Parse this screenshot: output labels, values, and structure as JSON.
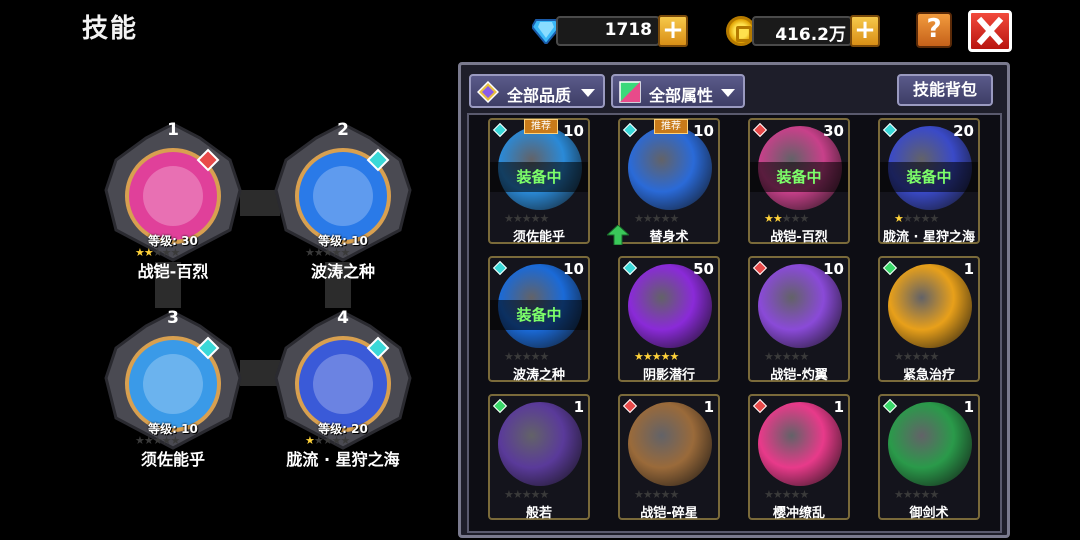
{
  "header": {
    "title": "技能"
  },
  "currency": {
    "gems": "1718",
    "coins": "416.2万",
    "plus": "+"
  },
  "buttons": {
    "help": "?"
  },
  "equipped": [
    {
      "slot": "1",
      "level": "等级: 30",
      "name": "战铠-百烈",
      "stars": 2,
      "color": "#e0409a"
    },
    {
      "slot": "2",
      "level": "等级: 10",
      "name": "波涛之种",
      "stars": 0,
      "color": "#2a7ae8"
    },
    {
      "slot": "3",
      "level": "等级: 10",
      "name": "须佐能乎",
      "stars": 0,
      "color": "#3a9ae8"
    },
    {
      "slot": "4",
      "level": "等级: 20",
      "name": "胧流 · 星狩之海",
      "stars": 1,
      "color": "#3a5ad8"
    }
  ],
  "filters": {
    "quality": "全部品质",
    "attribute": "全部属性",
    "bag": "技能背包"
  },
  "skills": [
    {
      "name": "须佐能乎",
      "count": "10",
      "stars": 0,
      "tag": "推荐",
      "equipped": "装备中",
      "color": "#2a8ad8",
      "qual": "#3ad8d8"
    },
    {
      "name": "替身术",
      "count": "10",
      "stars": 0,
      "tag": "推荐",
      "equipped": "",
      "color": "#2a6ad8",
      "qual": "#3ad8d8"
    },
    {
      "name": "战铠-百烈",
      "count": "30",
      "stars": 2,
      "tag": "",
      "equipped": "装备中",
      "color": "#c8408a",
      "qual": "#e84a4a"
    },
    {
      "name": "胧流 · 星狩之海",
      "count": "20",
      "stars": 1,
      "tag": "",
      "equipped": "装备中",
      "color": "#3a4ac8",
      "qual": "#3ad8d8"
    },
    {
      "name": "波涛之种",
      "count": "10",
      "stars": 0,
      "tag": "",
      "equipped": "装备中",
      "color": "#1a6ad8",
      "qual": "#3ad8d8"
    },
    {
      "name": "阴影潜行",
      "count": "50",
      "stars": 5,
      "tag": "",
      "equipped": "",
      "color": "#8a2ad8",
      "qual": "#3ad8d8"
    },
    {
      "name": "战铠-灼翼",
      "count": "10",
      "stars": 0,
      "tag": "",
      "equipped": "",
      "color": "#8a4ad8",
      "qual": "#e84a4a"
    },
    {
      "name": "紧急治疗",
      "count": "1",
      "stars": 0,
      "tag": "",
      "equipped": "",
      "color": "#e8a01a",
      "qual": "#3ad86a"
    },
    {
      "name": "般若",
      "count": "1",
      "stars": 0,
      "tag": "",
      "equipped": "",
      "color": "#5a3a9a",
      "qual": "#3ad86a"
    },
    {
      "name": "战铠-碎星",
      "count": "1",
      "stars": 0,
      "tag": "",
      "equipped": "",
      "color": "#9a6a3a",
      "qual": "#e84a4a"
    },
    {
      "name": "樱冲缭乱",
      "count": "1",
      "stars": 0,
      "tag": "",
      "equipped": "",
      "color": "#e83a8a",
      "qual": "#e84a4a"
    },
    {
      "name": "御剑术",
      "count": "1",
      "stars": 0,
      "tag": "",
      "equipped": "",
      "color": "#2a9a4a",
      "qual": "#3ad86a"
    }
  ]
}
